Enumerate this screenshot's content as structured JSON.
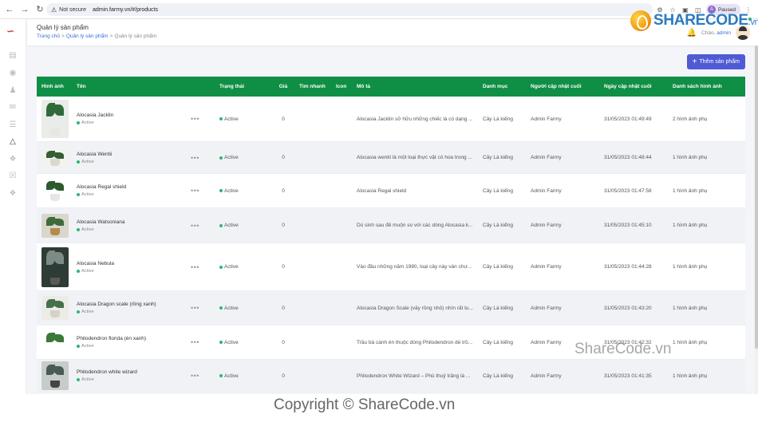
{
  "browser": {
    "security_label": "Not secure",
    "url": "admin.farmy.vn/#/products",
    "profile_initial": "A",
    "profile_status": "Paused"
  },
  "watermark": {
    "logo_main": "SHARECODE",
    "logo_suffix": ".vn",
    "mid_text": "ShareCode.vn",
    "bottom_text": "Copyright © ShareCode.vn"
  },
  "header": {
    "title": "Quản lý sản phẩm",
    "breadcrumb": [
      "Trang chủ",
      ">",
      "Quản lý sản phẩm",
      ">",
      "Quản lý sản phẩm"
    ],
    "greeting": "Chào,",
    "username": "admin"
  },
  "toolbar": {
    "add_label": "Thêm sản phẩm"
  },
  "table": {
    "columns": [
      "Hình ảnh",
      "Tên",
      "Trạng thái",
      "Giá",
      "Tìm nhanh",
      "Icon",
      "Mô tả",
      "Danh mục",
      "Người cập nhật cuối",
      "Ngày cập nhật cuối",
      "Danh sách hình ảnh"
    ],
    "rows": [
      {
        "name": "Alocasia Jacklin",
        "sub_status": "Active",
        "status": "Active",
        "price": "0",
        "quick": "",
        "icon": "",
        "description": "Alocasia Jacklin sở hữu những chiếc lá có dạng ...",
        "category": "Cây Lá kiểng",
        "updated_by": "Admin Farmy",
        "updated_at": "31/05/2023 01:49:49",
        "images": "2 hình ảnh phụ"
      },
      {
        "name": "Alocasia Wentii",
        "sub_status": "Active",
        "status": "Active",
        "price": "0",
        "quick": "",
        "icon": "",
        "description": "Alocasia wentii là một loại thực vật có hoa trong ...",
        "category": "Cây Lá kiểng",
        "updated_by": "Admin Farmy",
        "updated_at": "31/05/2023 01:48:44",
        "images": "1 hình ảnh phụ"
      },
      {
        "name": "Alocasia Regal shield",
        "sub_status": "Active",
        "status": "Active",
        "price": "0",
        "quick": "",
        "icon": "",
        "description": "Alocasia Regal shield",
        "category": "Cây Lá kiểng",
        "updated_by": "Admin Farmy",
        "updated_at": "31/05/2023 01:47:58",
        "images": "1 hình ảnh phụ"
      },
      {
        "name": "Alocasia Watsoniana",
        "sub_status": "Active",
        "status": "Active",
        "price": "0",
        "quick": "",
        "icon": "",
        "description": "Dù sinh sau đẻ muộn so với các dòng Alocasia k...",
        "category": "Cây Lá kiểng",
        "updated_by": "Admin Farmy",
        "updated_at": "31/05/2023 01:45:10",
        "images": "1 hình ảnh phụ"
      },
      {
        "name": "Alocasia Nebula",
        "sub_status": "Active",
        "status": "Active",
        "price": "0",
        "quick": "",
        "icon": "",
        "description": "Vào đầu những năm 1980, loại cây này vẫn chư...",
        "category": "Cây Lá kiểng",
        "updated_by": "Admin Farmy",
        "updated_at": "31/05/2023 01:44:28",
        "images": "1 hình ảnh phụ"
      },
      {
        "name": "Alocasia Dragon scale (rồng xanh)",
        "sub_status": "Active",
        "status": "Active",
        "price": "0",
        "quick": "",
        "icon": "",
        "description": "Alocasia Dragon Scale (vảy rồng nhỏ) nhìn rất tu...",
        "category": "Cây Lá kiểng",
        "updated_by": "Admin Farmy",
        "updated_at": "31/05/2023 01:43:20",
        "images": "1 hình ảnh phụ"
      },
      {
        "name": "Philodendron florida (én xanh)",
        "sub_status": "Active",
        "status": "Active",
        "price": "0",
        "quick": "",
        "icon": "",
        "description": "Trầu bà cánh én thuộc dòng Philodendron dễ trồ...",
        "category": "Cây Lá kiểng",
        "updated_by": "Admin Farmy",
        "updated_at": "31/05/2023 01:42:32",
        "images": "1 hình ảnh phụ"
      },
      {
        "name": "Philodendron white wizard",
        "sub_status": "Active",
        "status": "Active",
        "price": "0",
        "quick": "",
        "icon": "",
        "description": "Philodendron White Wizard – Phù thuỷ trắng là ...",
        "category": "Cây Lá kiểng",
        "updated_by": "Admin Farmy",
        "updated_at": "31/05/2023 01:41:35",
        "images": "1 hình ảnh phụ"
      }
    ]
  },
  "colors": {
    "header_green": "#0f8f45",
    "accent_blue": "#4f5bd5",
    "status_green": "#2bb673"
  }
}
